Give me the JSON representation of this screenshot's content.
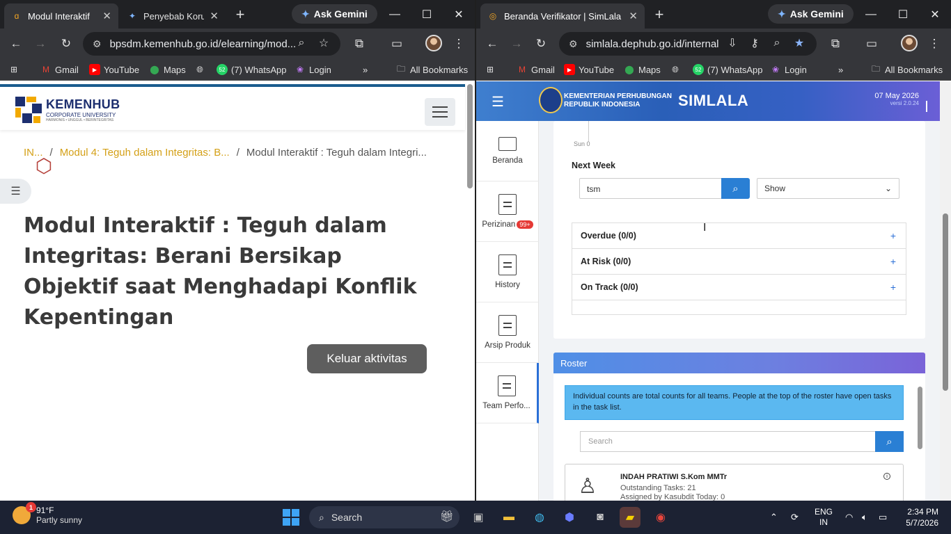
{
  "left_window": {
    "tabs": [
      {
        "title": "Modul Interaktif"
      },
      {
        "title": "Penyebab Korup"
      }
    ],
    "gemini": "Ask Gemini",
    "url": "bpsdm.kemenhub.go.id/elearning/mod...",
    "bookmarks": [
      "Gmail",
      "YouTube",
      "Maps",
      "(7) WhatsApp",
      "Login"
    ],
    "bookmarks_more": "»",
    "all_bookmarks": "All Bookmarks",
    "logo": {
      "brand": "KEMENHUB",
      "sub": "CORPORATE UNIVERSITY",
      "tagline": "HARMONIS • UNGGUL • BERINTEGRITAS"
    },
    "breadcrumb": {
      "c1": "IN...",
      "c2": "Modul 4: Teguh dalam Integritas: B...",
      "c3": "Modul Interaktif : Teguh dalam Integri...",
      "sep": "/"
    },
    "title": "Modul Interaktif : Teguh dalam Integritas: Berani Bersikap Objektif saat Menghadapi Konflik Kepentingan",
    "exit_label": "Keluar aktivitas"
  },
  "right_window": {
    "tabs": [
      {
        "title": "Beranda Verifikator | SimLala"
      }
    ],
    "gemini": "Ask Gemini",
    "url": "simlala.dephub.go.id/internal",
    "bookmarks": [
      "Gmail",
      "YouTube",
      "Maps",
      "(7) WhatsApp",
      "Login"
    ],
    "bookmarks_more": "»",
    "all_bookmarks": "All Bookmarks",
    "header": {
      "ministry_line1": "KEMENTERIAN PERHUBUNGAN",
      "ministry_line2": "REPUBLIK INDONESIA",
      "app": "SIMLALA",
      "date": "07 May 2026",
      "version": "versi 2.0.24"
    },
    "sidebar": [
      {
        "label": "Beranda"
      },
      {
        "label": "Perizinan",
        "badge": "99+"
      },
      {
        "label": "History"
      },
      {
        "label": "Arsip Produk"
      },
      {
        "label": "Team Perfo..."
      }
    ],
    "chart_tick": "Sun 0",
    "next_week": {
      "label": "Next Week",
      "search_value": "tsm",
      "show_select": "Show"
    },
    "accordion": [
      {
        "label": "Overdue (0/0)"
      },
      {
        "label": "At Risk (0/0)"
      },
      {
        "label": "On Track (0/0)"
      }
    ],
    "roster": {
      "title": "Roster",
      "info": "Individual counts are total counts for all teams. People at the top of the roster have open tasks in the task list.",
      "search_placeholder": "Search",
      "person": {
        "name": "INDAH PRATIWI S.Kom MMTr",
        "outstanding": "Outstanding Tasks: 21",
        "assigned": "Assigned by Kasubdit Today: 0"
      }
    }
  },
  "taskbar": {
    "weather": {
      "temp": "91°F",
      "desc": "Partly sunny",
      "badge": "1"
    },
    "search": "Search",
    "lang": "ENG",
    "region": "IN",
    "time": "2:34 PM",
    "date": "5/7/2026"
  }
}
